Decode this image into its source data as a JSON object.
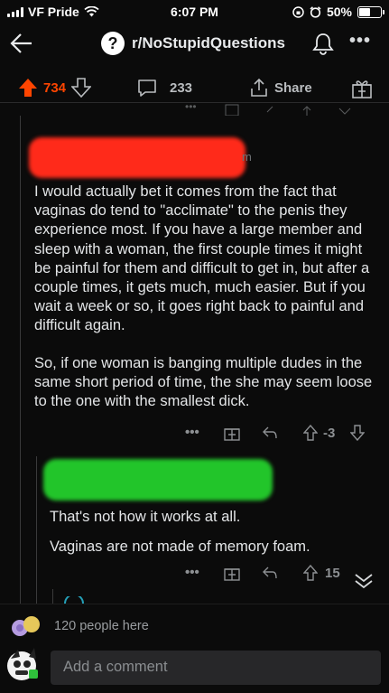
{
  "status_bar": {
    "carrier": "VF Pride",
    "time": "6:07 PM",
    "battery": "50%",
    "battery_level": 0.5
  },
  "header": {
    "subreddit": "r/NoStupidQuestions",
    "subreddit_icon": "?",
    "icons": [
      "back-arrow-icon",
      "bell-icon",
      "more-icon"
    ]
  },
  "post_actions": {
    "upvotes": "734",
    "comments": "233",
    "share_label": "Share"
  },
  "comments": [
    {
      "username_redacted_color": "#ff2a1a",
      "username_suffix": "m",
      "paragraphs": [
        "I would actually bet it comes from the fact that vaginas do tend to \"acclimate\" to the penis they experience most. If you have a large member and sleep with a woman, the first couple times it might be painful for them and difficult to get in, but after a couple times, it gets much, much easier. But if you wait a week or so, it goes right back to painful and difficult again.",
        "So, if one woman is banging multiple dudes in the same short period of time, the she may seem loose to the one with the smallest dick."
      ],
      "tools": {
        "more": "•••",
        "score": "-3"
      }
    },
    {
      "username_redacted_color": "#22c52a",
      "paragraphs": [
        "That's not how it works at all.",
        "Vaginas are not made of memory foam."
      ],
      "tools": {
        "more": "•••",
        "score": "15"
      }
    }
  ],
  "footer": {
    "presence": "120 people here",
    "comment_placeholder": "Add a comment"
  }
}
